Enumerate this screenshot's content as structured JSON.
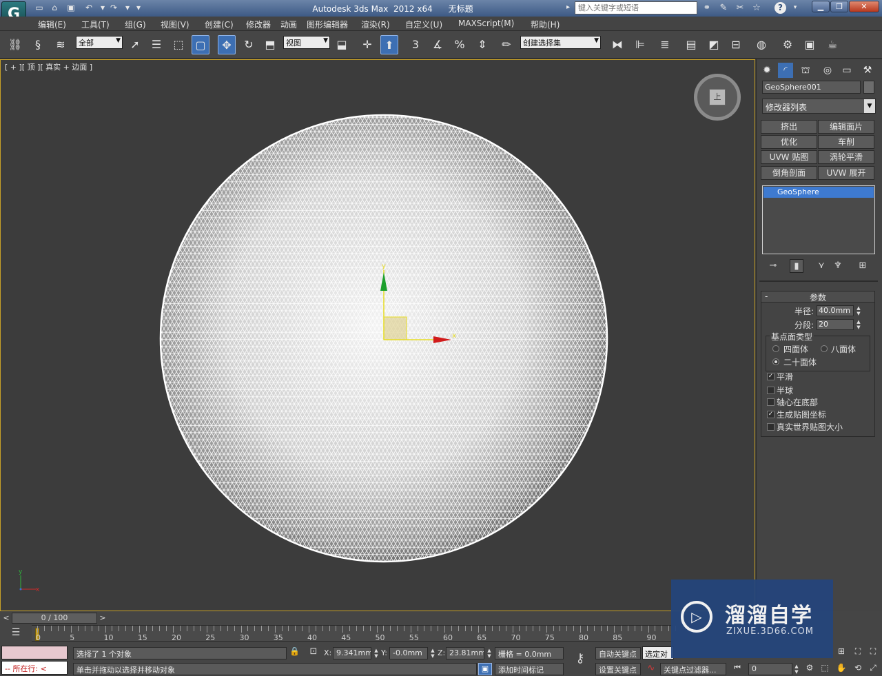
{
  "title_bar": {
    "logo": "G",
    "app_title": "Autodesk 3ds Max  2012 x64      无标题",
    "search_placeholder": "键入关键字或短语",
    "help_label": "?"
  },
  "menu": [
    "编辑(E)",
    "工具(T)",
    "组(G)",
    "视图(V)",
    "创建(C)",
    "修改器",
    "动画",
    "图形编辑器",
    "渲染(R)",
    "自定义(U)",
    "MAXScript(M)",
    "帮助(H)"
  ],
  "toolbar": {
    "filter_dropdown": "全部",
    "ref_coord_dropdown": "视图",
    "snap_3": "3",
    "snap_percent": "%",
    "selection_set": "创建选择集"
  },
  "viewport": {
    "label": "[ + ][ 顶 ][ 真实 + 边面 ]",
    "viewcube_face": "上",
    "gizmo_y": "y",
    "gizmo_x": "x",
    "mini_axis_y": "y",
    "mini_axis_x": "x"
  },
  "command_panel": {
    "object_name": "GeoSphere001",
    "modifier_list": "修改器列表",
    "modifier_buttons": [
      "挤出",
      "编辑面片",
      "优化",
      "车削",
      "UVW 贴图",
      "涡轮平滑",
      "倒角剖面",
      "UVW 展开"
    ],
    "stack_item": "GeoSphere",
    "rollout_title": "参数",
    "radius_label": "半径:",
    "radius_value": "40.0mm",
    "segments_label": "分段:",
    "segments_value": "20",
    "base_type_label": "基点面类型",
    "base_types": [
      {
        "label": "四面体",
        "selected": false
      },
      {
        "label": "八面体",
        "selected": false
      },
      {
        "label": "二十面体",
        "selected": true
      }
    ],
    "checkboxes": [
      {
        "label": "平滑",
        "checked": true
      },
      {
        "label": "半球",
        "checked": false
      },
      {
        "label": "轴心在底部",
        "checked": false
      },
      {
        "label": "生成贴图坐标",
        "checked": true
      },
      {
        "label": "真实世界贴图大小",
        "checked": false
      }
    ]
  },
  "timeline": {
    "frame_slider": "0 / 100",
    "ticks": [
      "0",
      "5",
      "10",
      "15",
      "20",
      "25",
      "30",
      "35",
      "40",
      "45",
      "50",
      "55",
      "60",
      "65",
      "70",
      "75",
      "80",
      "85",
      "90"
    ]
  },
  "status": {
    "maxscript_label": "所在行:",
    "selected_text": "选择了 1 个对象",
    "prompt_text": "单击并拖动以选择并移动对象",
    "x_label": "X:",
    "x_value": "9.341mm",
    "y_label": "Y:",
    "y_value": "-0.0mm",
    "z_label": "Z:",
    "z_value": "23.81mm",
    "grid_text": "栅格 = 0.0mm",
    "add_time_tag": "添加时间标记",
    "auto_key": "自动关键点",
    "set_key": "设置关键点",
    "selected_dropdown": "选定对",
    "key_filters": "关键点过滤器...",
    "frame_value": "0"
  },
  "watermark": {
    "title": "溜溜自学",
    "subtitle": "ZIXUE.3D66.COM"
  },
  "colors": {
    "accent_blue": "#3d6fb3",
    "viewport_border": "#c9a227",
    "watermark_bg": "#24457c"
  }
}
